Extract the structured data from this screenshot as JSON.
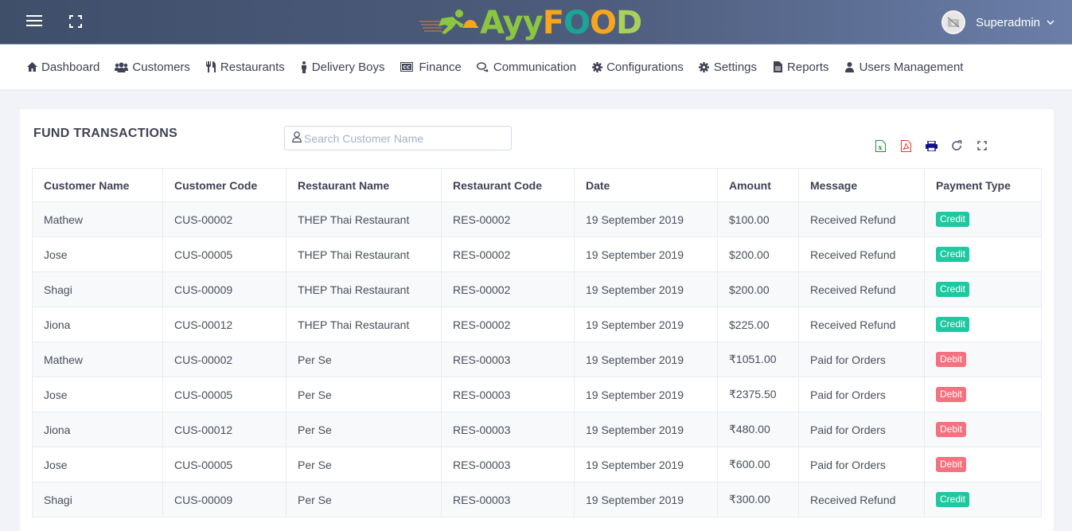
{
  "header": {
    "logo": {
      "a": "Ayy",
      "f": "F",
      "o1": "O",
      "o2": "O",
      "d": "D"
    },
    "user_name": "Superadmin",
    "icons": [
      "menu-icon",
      "fullscreen-icon",
      "user-avatar-icon",
      "chevron-down-icon"
    ]
  },
  "nav": {
    "items": [
      {
        "label": "Dashboard",
        "icon": "home-icon"
      },
      {
        "label": "Customers",
        "icon": "users-icon"
      },
      {
        "label": "Restaurants",
        "icon": "cutlery-icon"
      },
      {
        "label": "Delivery Boys",
        "icon": "male-icon"
      },
      {
        "label": "Finance",
        "icon": "cc-icon"
      },
      {
        "label": "Communication",
        "icon": "comments-icon"
      },
      {
        "label": "Configurations",
        "icon": "cog-icon"
      },
      {
        "label": "Settings",
        "icon": "cog-icon"
      },
      {
        "label": "Reports",
        "icon": "file-icon"
      },
      {
        "label": "Users Management",
        "icon": "user-icon"
      }
    ]
  },
  "page": {
    "title": "FUND TRANSACTIONS",
    "search": {
      "placeholder": "Search Customer Name",
      "value": ""
    },
    "tools": [
      "excel-export",
      "pdf-export",
      "print",
      "refresh",
      "fullscreen"
    ]
  },
  "colors": {
    "credit": "#1dc9a0",
    "debit": "#f4717f",
    "header_bg": "#4d5c7c"
  },
  "table": {
    "columns": [
      "Customer Name",
      "Customer Code",
      "Restaurant Name",
      "Restaurant Code",
      "Date",
      "Amount",
      "Message",
      "Payment Type"
    ],
    "rows": [
      {
        "customer": "Mathew",
        "ccode": "CUS-00002",
        "restaurant": "THEP Thai Restaurant",
        "rcode": "RES-00002",
        "date": "19 September 2019",
        "amount": "$100.00",
        "message": "Received Refund",
        "type": "Credit"
      },
      {
        "customer": "Jose",
        "ccode": "CUS-00005",
        "restaurant": "THEP Thai Restaurant",
        "rcode": "RES-00002",
        "date": "19 September 2019",
        "amount": "$200.00",
        "message": "Received Refund",
        "type": "Credit"
      },
      {
        "customer": "Shagi",
        "ccode": "CUS-00009",
        "restaurant": "THEP Thai Restaurant",
        "rcode": "RES-00002",
        "date": "19 September 2019",
        "amount": "$200.00",
        "message": "Received Refund",
        "type": "Credit"
      },
      {
        "customer": "Jiona",
        "ccode": "CUS-00012",
        "restaurant": "THEP Thai Restaurant",
        "rcode": "RES-00002",
        "date": "19 September 2019",
        "amount": "$225.00",
        "message": "Received Refund",
        "type": "Credit"
      },
      {
        "customer": "Mathew",
        "ccode": "CUS-00002",
        "restaurant": "Per Se",
        "rcode": "RES-00003",
        "date": "19 September 2019",
        "amount": "₹1051.00",
        "message": "Paid for Orders",
        "type": "Debit"
      },
      {
        "customer": "Jose",
        "ccode": "CUS-00005",
        "restaurant": "Per Se",
        "rcode": "RES-00003",
        "date": "19 September 2019",
        "amount": "₹2375.50",
        "message": "Paid for Orders",
        "type": "Debit"
      },
      {
        "customer": "Jiona",
        "ccode": "CUS-00012",
        "restaurant": "Per Se",
        "rcode": "RES-00003",
        "date": "19 September 2019",
        "amount": "₹480.00",
        "message": "Paid for Orders",
        "type": "Debit"
      },
      {
        "customer": "Jose",
        "ccode": "CUS-00005",
        "restaurant": "Per Se",
        "rcode": "RES-00003",
        "date": "19 September 2019",
        "amount": "₹600.00",
        "message": "Paid for Orders",
        "type": "Debit"
      },
      {
        "customer": "Shagi",
        "ccode": "CUS-00009",
        "restaurant": "Per Se",
        "rcode": "RES-00003",
        "date": "19 September 2019",
        "amount": "₹300.00",
        "message": "Received Refund",
        "type": "Credit"
      }
    ]
  }
}
